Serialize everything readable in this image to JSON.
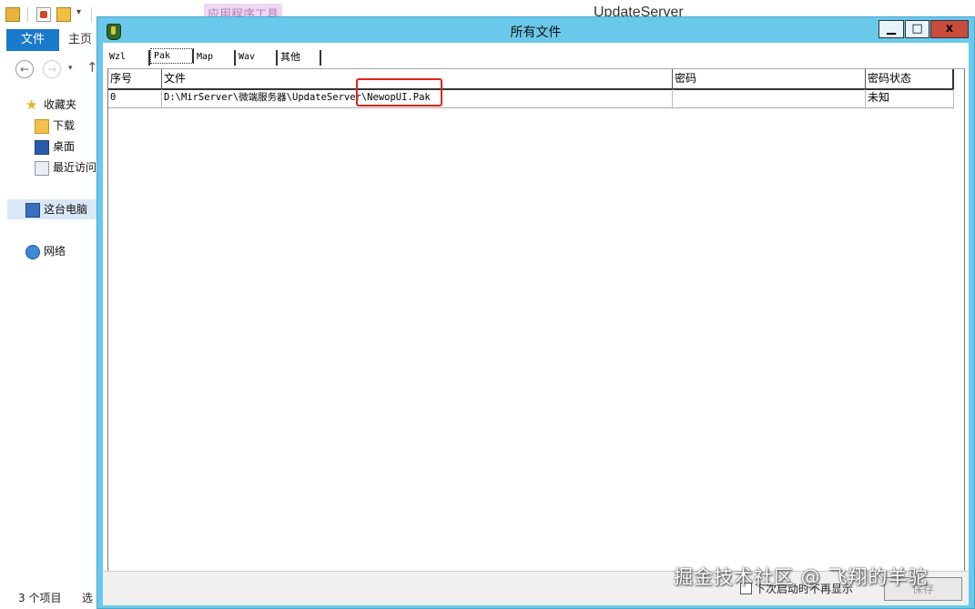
{
  "explorer": {
    "window_title": "UpdateServer",
    "context_tab": "应用程序工具",
    "ribbon_tabs": [
      "文件",
      "主页"
    ],
    "nav": {
      "favorites": "收藏夹",
      "downloads": "下载",
      "desktop": "桌面",
      "recent": "最近访问",
      "this_pc": "这台电脑",
      "network": "网络"
    },
    "status": {
      "items": "3 个项目",
      "selected": "选"
    }
  },
  "dialog": {
    "title": "所有文件",
    "window_buttons": {
      "minimize": "▁",
      "maximize": "□",
      "close": "x"
    },
    "tabs": [
      "Wzl",
      "Pak",
      "Map",
      "Wav",
      "其他"
    ],
    "active_tab": "Pak",
    "columns": [
      "序号",
      "文件",
      "密码",
      "密码状态"
    ],
    "rows": [
      {
        "index": "0",
        "file": "D:\\MirServer\\微端服务器\\UpdateServer\\NewopUI.Pak",
        "password": "",
        "password_state": "未知"
      }
    ],
    "highlight_color": "#e2231a",
    "checkbox_label": "下次启动时不再显示",
    "save_button": "保存"
  },
  "watermark": "掘金技术社区 @ 飞翔的羊驼",
  "colors": {
    "dialog_frame": "#6ac9ea",
    "ribbon_file_tab": "#1979ca",
    "close_button": "#c94c3c"
  }
}
